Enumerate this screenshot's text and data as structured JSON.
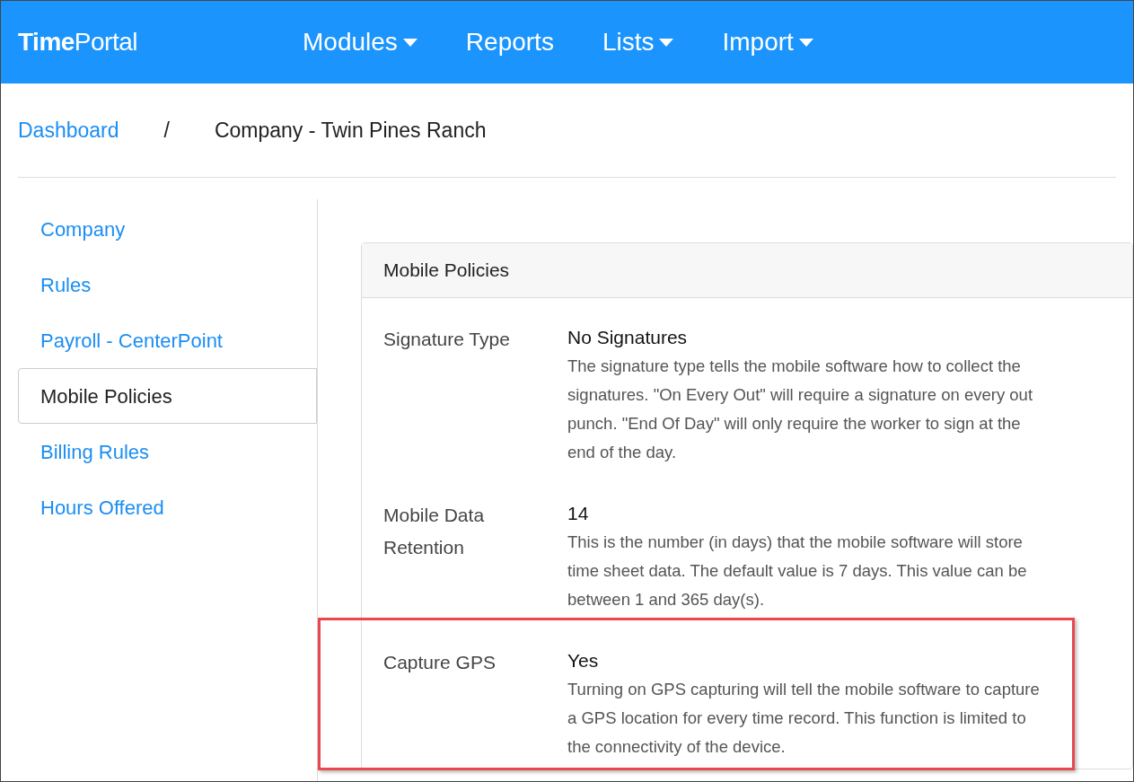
{
  "header": {
    "logo": "**Time**Portal",
    "nav": [
      {
        "label": "Modules",
        "dropdown": true
      },
      {
        "label": "Reports",
        "dropdown": false
      },
      {
        "label": "Lists",
        "dropdown": true
      },
      {
        "label": "Import",
        "dropdown": true
      }
    ]
  },
  "breadcrumb": {
    "link": "Dashboard",
    "separator": "/",
    "current": "Company - Twin Pines Ranch"
  },
  "sidebar": {
    "items": [
      {
        "label": "Company",
        "selected": false
      },
      {
        "label": "Rules",
        "selected": false
      },
      {
        "label": "Payroll - CenterPoint",
        "selected": false
      },
      {
        "label": "Mobile Policies",
        "selected": true
      },
      {
        "label": "Billing Rules",
        "selected": false
      },
      {
        "label": "Hours Offered",
        "selected": false
      }
    ]
  },
  "card": {
    "title": "Mobile Policies",
    "policies": [
      {
        "label": "Signature Type",
        "value": "No Signatures",
        "description": "The signature type tells the mobile software how to collect the signatures. \"On Every Out\" will require a signature on every out punch. \"End Of Day\" will only require the worker to sign at the end of the day.",
        "highlighted": false
      },
      {
        "label": "Mobile Data Retention",
        "value": "14",
        "description": "This is the number (in days) that the mobile software will store time sheet data. The default value is 7 days. This value can be between 1 and 365 day(s).",
        "highlighted": false
      },
      {
        "label": "Capture GPS",
        "value": "Yes",
        "description": "Turning on GPS capturing will tell the mobile software to capture a GPS location for every time record. This function is limited to the connectivity of the device.",
        "highlighted": true
      }
    ]
  }
}
